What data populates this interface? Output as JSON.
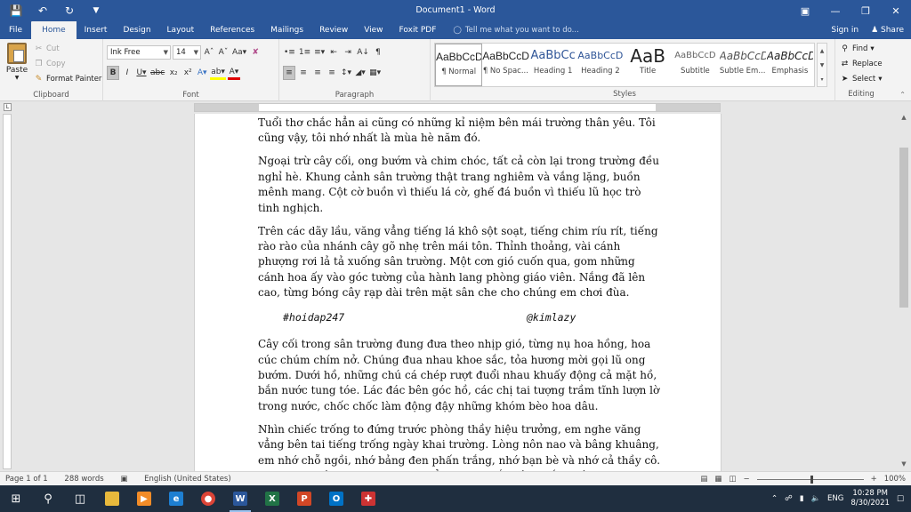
{
  "window": {
    "title": "Document1 - Word",
    "qat": {
      "save_icon": "save-icon",
      "undo_icon": "undo-icon",
      "redo_icon": "redo-icon"
    }
  },
  "tabs": [
    "File",
    "Home",
    "Insert",
    "Design",
    "Layout",
    "References",
    "Mailings",
    "Review",
    "View",
    "Foxit PDF"
  ],
  "tell_me": "Tell me what you want to do...",
  "account": {
    "sign_in": "Sign in",
    "share": "Share"
  },
  "ribbon": {
    "clipboard": {
      "paste": "Paste",
      "cut": "Cut",
      "copy": "Copy",
      "format_painter": "Format Painter",
      "label": "Clipboard"
    },
    "font": {
      "name": "Ink Free",
      "size": "14",
      "label": "Font"
    },
    "paragraph": {
      "label": "Paragraph"
    },
    "styles": {
      "label": "Styles",
      "items": [
        {
          "preview": "AaBbCcDc",
          "name": "¶ Normal"
        },
        {
          "preview": "AaBbCcDc",
          "name": "¶ No Spac..."
        },
        {
          "preview": "AaBbCc",
          "name": "Heading 1"
        },
        {
          "preview": "AaBbCcD",
          "name": "Heading 2"
        },
        {
          "preview": "AaB",
          "name": "Title"
        },
        {
          "preview": "AaBbCcD",
          "name": "Subtitle"
        },
        {
          "preview": "AaBbCcDi",
          "name": "Subtle Em..."
        },
        {
          "preview": "AaBbCcDi",
          "name": "Emphasis"
        }
      ]
    },
    "editing": {
      "find": "Find",
      "replace": "Replace",
      "select": "Select",
      "label": "Editing"
    }
  },
  "document": {
    "paragraphs": [
      "Tuổi thơ chắc hẳn ai cũng có những kỉ niệm bên mái trường thân yêu. Tôi cũng vậy, tôi nhớ nhất là mùa hè năm đó.",
      "Ngoại trừ cây cối, ong bướm và chim chóc, tất cả còn lại trong trường đều nghỉ hè. Khung cảnh sân trường thật trang nghiêm và vắng lặng, buồn mênh mang. Cột cờ buồn vì thiếu lá cờ, ghế đá buồn vì thiếu lũ học trò tinh nghịch.",
      "Trên các dãy lầu, văng vẳng tiếng lá khô sột soạt, tiếng chim ríu rít, tiếng rào rào của nhánh cây gõ nhẹ trên mái tôn. Thỉnh thoảng, vài cánh phượng rơi lả tả xuống sân trường. Một cơn gió cuốn qua, gom những cánh hoa ấy vào góc tường của hành lang phòng giáo viên. Nắng đã lên cao, từng bóng cây rạp dài trên mặt sân che cho chúng em chơi đùa.",
      "Cây cối trong sân trường đung đưa theo nhịp gió, từng nụ hoa hồng, hoa cúc chúm chím nở. Chúng đua nhau khoe sắc, tỏa hương mời gọi lũ ong bướm. Dưới hồ, những chú cá chép rượt đuổi nhau khuấy động cả mặt hồ, bắn nước tung tóe. Lác đác bên góc hồ, các chị tai tượng trầm tĩnh lượn lờ trong nước, chốc chốc làm động đậy những khóm bèo hoa dâu.",
      "Nhìn chiếc trống to đứng trước phòng thầy hiệu trưởng, em nghe văng vẳng bên tai tiếng trống ngày khai trường. Lòng nôn nao và bâng khuâng, em nhớ chỗ ngồi, nhớ bảng đen phấn trắng, nhớ bạn bè và nhớ cả thầy cô. Em mong thời gian qua nhanh để em được cắp sách đến trường, chia xa những ngày hè êm ái."
    ],
    "tag_left": "#hoidap247",
    "tag_right": "@kimlazy"
  },
  "status": {
    "page": "Page 1 of 1",
    "words": "288 words",
    "language": "English (United States)",
    "zoom": "100%"
  },
  "taskbar": {
    "time": "10:28 PM",
    "date": "8/30/2021",
    "lang": "ENG"
  },
  "colors": {
    "word_blue": "#2b579a",
    "taskbar": "#1f2e3f"
  }
}
